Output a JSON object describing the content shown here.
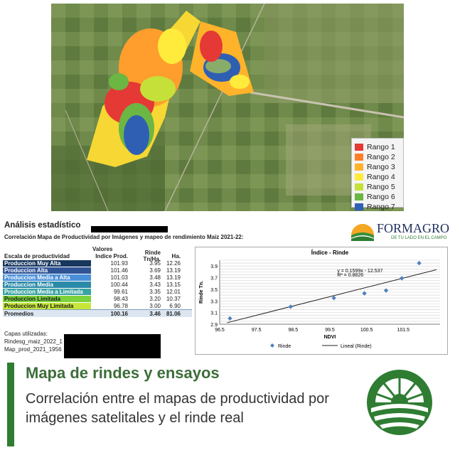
{
  "map": {
    "legend": [
      {
        "label": "Rango 1",
        "color": "#e53935"
      },
      {
        "label": "Rango 2",
        "color": "#ff7f27"
      },
      {
        "label": "Rango 3",
        "color": "#ffb32b"
      },
      {
        "label": "Rango 4",
        "color": "#ffeb3b"
      },
      {
        "label": "Rango 5",
        "color": "#c6e03a"
      },
      {
        "label": "Rango 6",
        "color": "#6cb644"
      },
      {
        "label": "Rango 7",
        "color": "#2f5fb3"
      }
    ]
  },
  "stats": {
    "title": "Análisis estadístico",
    "subtitle": "Correlación Mapa de Productividad por Imágenes y mapeo de rendimiento Maiz 2021-22:",
    "valores_label": "Valores",
    "columns": [
      "Escala de productividad",
      "Indice Prod.",
      "Rinde Tn/Ha.",
      "Ha."
    ],
    "rows": [
      {
        "name": "Produccion Muy Alta",
        "indice": "101.93",
        "rinde": "3.95",
        "ha": "12.26",
        "color": "#17375e"
      },
      {
        "name": "Produccion Alta",
        "indice": "101.46",
        "rinde": "3.69",
        "ha": "13.19",
        "color": "#2f5496"
      },
      {
        "name": "Produccion Media a Alta",
        "indice": "101.03",
        "rinde": "3.48",
        "ha": "13.19",
        "color": "#4a90d9"
      },
      {
        "name": "Produccion Media",
        "indice": "100.44",
        "rinde": "3.43",
        "ha": "13.15",
        "color": "#2b8aa8"
      },
      {
        "name": "Produccion Media a Limitada",
        "indice": "99.61",
        "rinde": "3.35",
        "ha": "12.01",
        "color": "#3aa3a3"
      },
      {
        "name": "Produccion Limitada",
        "indice": "98.43",
        "rinde": "3.20",
        "ha": "10.37",
        "color": "#7bd23a"
      },
      {
        "name": "Produccion Muy Limitada",
        "indice": "96.78",
        "rinde": "3.00",
        "ha": "6.90",
        "color": "#c8e63a"
      }
    ],
    "promedios": {
      "name": "Promedios",
      "indice": "100.16",
      "rinde": "3.46",
      "ha": "81.06"
    },
    "capas_label": "Capas utilizadas:",
    "capas": [
      "Rindesg_maiz_2022_1",
      "Map_prod_2021_1956"
    ]
  },
  "brand": {
    "name": "FORMAGRO",
    "tagline": "DE TU LADO EN EL CAMPO"
  },
  "chart_data": {
    "type": "scatter",
    "title": "Índice - Rinde",
    "xlabel": "NDVI",
    "ylabel": "Rinde Tn.",
    "xlim": [
      96.5,
      102.5
    ],
    "ylim": [
      2.9,
      4.0
    ],
    "xticks": [
      "96.5",
      "97.5",
      "98.5",
      "99.5",
      "100.5",
      "101.5"
    ],
    "yticks": [
      "2.9",
      "3.1",
      "3.3",
      "3.5",
      "3.7",
      "3.9"
    ],
    "grid": true,
    "series": [
      {
        "name": "Rinde",
        "x": [
          96.78,
          98.43,
          99.61,
          100.44,
          101.03,
          101.46,
          101.93
        ],
        "y": [
          3.0,
          3.2,
          3.35,
          3.43,
          3.48,
          3.69,
          3.95
        ],
        "color": "#4f81bd"
      },
      {
        "name": "Lineal (Rinde)",
        "type": "line",
        "slope": 0.1599,
        "intercept": -12.537,
        "color": "#222222"
      }
    ],
    "equation": "y = 0.1599x - 12.537",
    "r2": "R² = 0.8826",
    "legend_position": "bottom"
  },
  "caption": {
    "title": "Mapa de rindes y ensayos",
    "subtitle": "Correlación entre el mapas de productividad por imágenes satelitales y el rinde real"
  }
}
